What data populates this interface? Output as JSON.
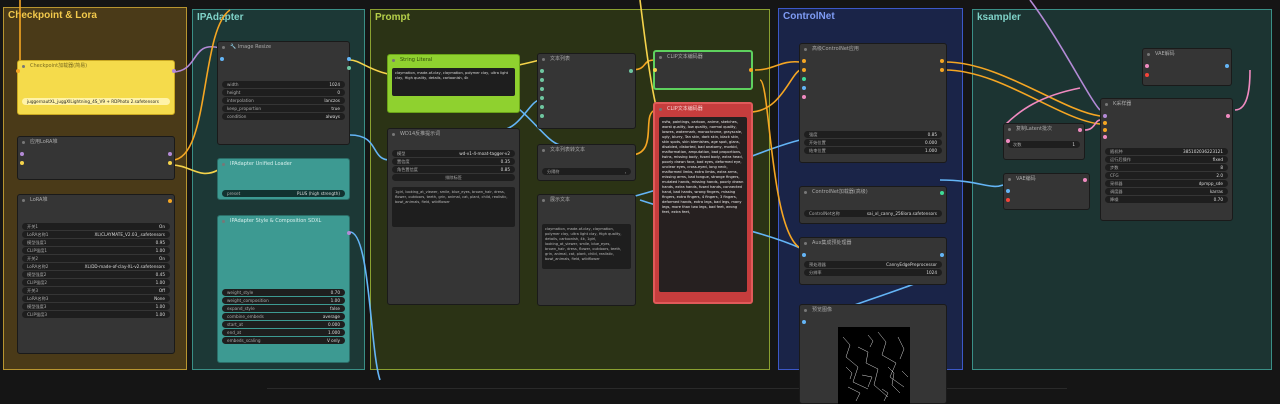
{
  "groups": {
    "checkpoint": "Checkpoint & Lora",
    "ipadapter": "IPAdapter",
    "prompt": "Prompt",
    "controlnet": "ControlNet",
    "ksampler": "ksampler"
  },
  "colors": {
    "checkpoint_group": "#b89530",
    "ipadapter_group": "#3a8f86",
    "prompt_group": "#8aa030",
    "controlnet_group": "#3c58c8",
    "ksampler_group": "#3a8f86",
    "yellow_node": "#f5db4b",
    "green_node": "#8fd12f",
    "red_node": "#c63d3d",
    "teal_node": "#3d9a92"
  },
  "nodes": {
    "checkpoint_loader": {
      "title": "Checkpoint加载器(简易)",
      "ckpt": "juggernautXL_juggXILightning_4S_V9 + RDPhoto 2.safetensors"
    },
    "lora_apply": {
      "title": "应用LoRA堆"
    },
    "lora_stack": {
      "title": "LoRA堆",
      "rows": [
        {
          "label": "开关1",
          "value": "On"
        },
        {
          "label": "LoRA名称1",
          "value": "XL\\CLAYMATE_V2.03_.safetensors"
        },
        {
          "label": "模型强度1",
          "value": "0.95"
        },
        {
          "label": "CLIP强度1",
          "value": "1.00"
        },
        {
          "label": "开关2",
          "value": "On"
        },
        {
          "label": "LoRA名称2",
          "value": "XL\\DD-made-of-clay-XL-v2.safetensors"
        },
        {
          "label": "模型强度2",
          "value": "0.45"
        },
        {
          "label": "CLIP强度2",
          "value": "1.00"
        },
        {
          "label": "开关3",
          "value": "Off"
        },
        {
          "label": "LoRA名称3",
          "value": "None"
        },
        {
          "label": "模型强度3",
          "value": "1.00"
        },
        {
          "label": "CLIP强度3",
          "value": "1.00"
        }
      ]
    },
    "image_resize": {
      "title": "🔧 Image Resize",
      "rows": [
        {
          "label": "width",
          "value": "1024"
        },
        {
          "label": "height",
          "value": "0"
        },
        {
          "label": "interpolation",
          "value": "lanczos"
        },
        {
          "label": "keep_proportion",
          "value": "true"
        },
        {
          "label": "condition",
          "value": "always"
        }
      ]
    },
    "ipadapter_unified": {
      "title": "IPAdapter Unified Loader",
      "preset_label": "preset",
      "preset_value": "PLUS (high strength)"
    },
    "ipadapter_style": {
      "title": "IPAdapter Style & Composition SDXL",
      "rows": [
        {
          "label": "weight_style",
          "value": "0.70"
        },
        {
          "label": "weight_composition",
          "value": "1.00"
        },
        {
          "label": "expand_style",
          "value": "false"
        },
        {
          "label": "combine_embeds",
          "value": "average"
        },
        {
          "label": "start_at",
          "value": "0.000"
        },
        {
          "label": "end_at",
          "value": "1.000"
        },
        {
          "label": "embeds_scaling",
          "value": "V only"
        }
      ]
    },
    "string_literal": {
      "title": "String Literal",
      "text": "claymation, made-of-clay, claymation, polymer clay, ultra light clay, High quality, details, cartoonish, 4k"
    },
    "wd14": {
      "title": "WD14反推提示词",
      "rows": [
        {
          "label": "模型",
          "value": "wd-v1-4-moat-tagger-v2"
        },
        {
          "label": "置信度",
          "value": "0.35"
        },
        {
          "label": "角色置信度",
          "value": "0.85"
        }
      ],
      "button": "排除标签",
      "output": "1girl, looking_at_viewer, smile, blue_eyes, brown_hair, dress, flower, outdoors, teeth, grin, animal, cat, plant, child, realistic, bowl_animals, field, wildflower"
    },
    "text_list": {
      "title": "文本列表"
    },
    "text_replace": {
      "title": "文本列表转文本",
      "sep": "分隔符"
    },
    "show_text": {
      "title": "展示文本",
      "text": "claymation, made-of-clay, claymation, polymer clay, ultra light clay, High quality, details, cartoonish, 4k, 1girl, looking_at_viewer, smile, blue_eyes, brown_hair, dress, flower, outdoors, teeth, grin, animal, cat, plant, child, realistic, bowl_animals, field, wildflower"
    },
    "clip_pos": {
      "title": "CLIP文本编码器"
    },
    "clip_neg": {
      "title": "CLIP文本编码器",
      "text": "nsfw, paintings, cartoon, anime, sketches, worst quality, low quality, normal quality, lowres, watermark, monochrome, grayscale, ugly, blurry, Tan skin, dark skin, black skin, skin spots, skin blemishes, age spot, glans, disabled, distorted, bad anatomy, morbid, malformation, amputation, bad proportions, twins, missing body, fused body, extra head, poorly drawn face, bad eyes, deformed eye, unclear eyes, cross-eyed, long neck, malformed limbs, extra limbs, extra arms, missing arms, bad tongue, strange fingers, mutated hands, missing hands, poorly drawn hands, extra hands, fused hands, connected hand, bad hands, wrong fingers, missing fingers, extra fingers, 4 fingers, 3 fingers, deformed hands, extra legs, bad legs, many legs, more than two legs, bad feet, wrong feet, extra feet,"
    },
    "cn_apply": {
      "title": "高级ControlNet应用",
      "rows": [
        {
          "label": "强度",
          "value": "0.85"
        },
        {
          "label": "开始位置",
          "value": "0.000"
        },
        {
          "label": "结束位置",
          "value": "1.000"
        }
      ]
    },
    "cn_loader": {
      "title": "ControlNet加载器(高级)",
      "label": "ControlNet名称",
      "value": "sai_xl_canny_256lora.safetensors"
    },
    "aux_pre": {
      "title": "Aux集成预处理器",
      "rows": [
        {
          "label": "预处理器",
          "value": "CannyEdgePreprocessor"
        },
        {
          "label": "分辨率",
          "value": "1024"
        }
      ]
    },
    "preview": {
      "title": "预览图像"
    },
    "latent_batch": {
      "title": "复制Latent批次",
      "label": "次数",
      "value": "1"
    },
    "vae_encode": {
      "title": "VAE编码"
    },
    "vae_decode": {
      "title": "VAE解码"
    },
    "ksampler": {
      "title": "K采样器",
      "rows": [
        {
          "label": "随机种",
          "value": "385102036223121"
        },
        {
          "label": "运行后操作",
          "value": "fixed"
        },
        {
          "label": "步数",
          "value": "8"
        },
        {
          "label": "CFG",
          "value": "2.0"
        },
        {
          "label": "采样器",
          "value": "dpmpp_sde"
        },
        {
          "label": "调度器",
          "value": "karras"
        },
        {
          "label": "降噪",
          "value": "0.70"
        }
      ]
    }
  }
}
